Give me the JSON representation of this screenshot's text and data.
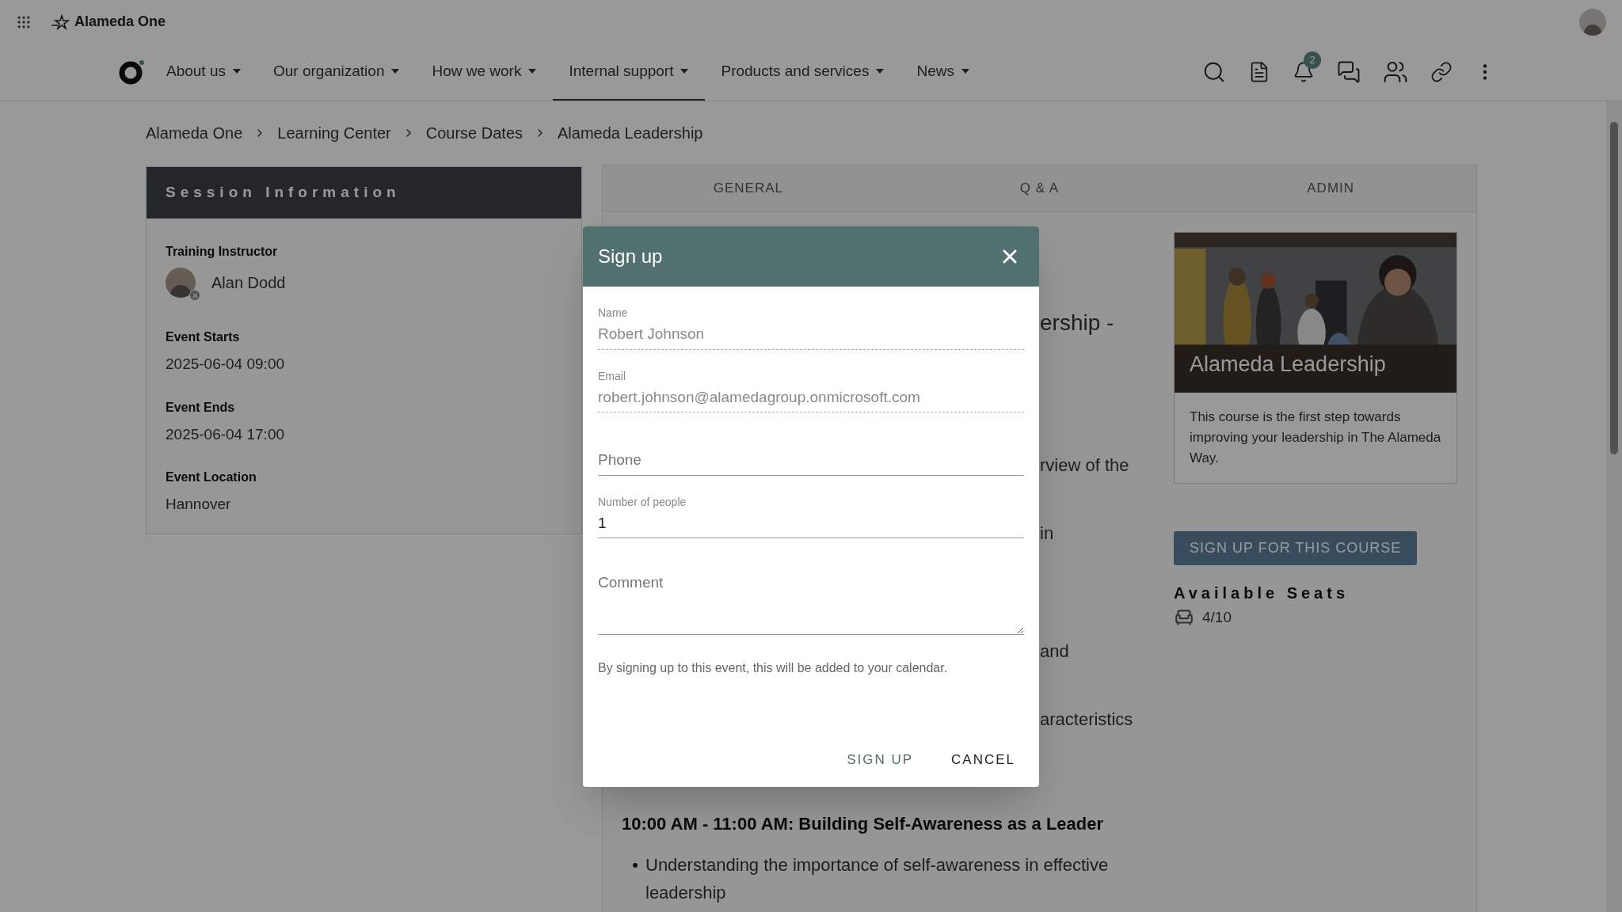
{
  "app": {
    "title": "Alameda One"
  },
  "nav": [
    {
      "label": "About us",
      "selected": false
    },
    {
      "label": "Our organization",
      "selected": false
    },
    {
      "label": "How we work",
      "selected": false
    },
    {
      "label": "Internal support",
      "selected": true
    },
    {
      "label": "Products and services",
      "selected": false
    },
    {
      "label": "News",
      "selected": false
    }
  ],
  "notification_count": "2",
  "breadcrumb": [
    "Alameda One",
    "Learning Center",
    "Course Dates",
    "Alameda Leadership"
  ],
  "session_info": {
    "title": "Session Information",
    "fields": [
      {
        "kind": "person",
        "label": "Training Instructor",
        "value": "Alan Dodd"
      },
      {
        "kind": "text",
        "label": "Event Starts",
        "value": "2025-06-04 09:00"
      },
      {
        "kind": "text",
        "label": "Event Ends",
        "value": "2025-06-04 17:00"
      },
      {
        "kind": "text",
        "label": "Event Location",
        "value": "Hannover"
      }
    ]
  },
  "tabs": [
    "GENERAL",
    "Q & A",
    "ADMIN"
  ],
  "content": {
    "fragments": [
      "ership -",
      "rview of the",
      "in",
      "and",
      "aracteristics"
    ],
    "heading": "10:00 AM - 11:00 AM: Building Self-Awareness as a Leader",
    "bullets": [
      "Understanding the importance of self-awareness in effective leadership"
    ]
  },
  "course_card": {
    "title": "Alameda Leadership",
    "description": "This course is the first step towards improving your leadership in The Alameda Way.",
    "button": "SIGN UP FOR THIS COURSE",
    "seats_label": "Available Seats",
    "seats": "4/10"
  },
  "dialog": {
    "title": "Sign up",
    "fields": [
      {
        "kind": "readonly",
        "label": "Name",
        "value": "Robert Johnson"
      },
      {
        "kind": "readonly",
        "label": "Email",
        "value": "robert.johnson@alamedagroup.onmicrosoft.com"
      },
      {
        "kind": "input",
        "placeholder": "Phone"
      },
      {
        "kind": "input",
        "label": "Number of people",
        "value": "1"
      },
      {
        "kind": "textarea",
        "placeholder": "Comment"
      }
    ],
    "note": "By signing up to this event, this will be added to your calendar.",
    "buttons": [
      {
        "label": "SIGN UP",
        "kind": "primary"
      },
      {
        "label": "CANCEL",
        "kind": "secondary"
      }
    ]
  }
}
